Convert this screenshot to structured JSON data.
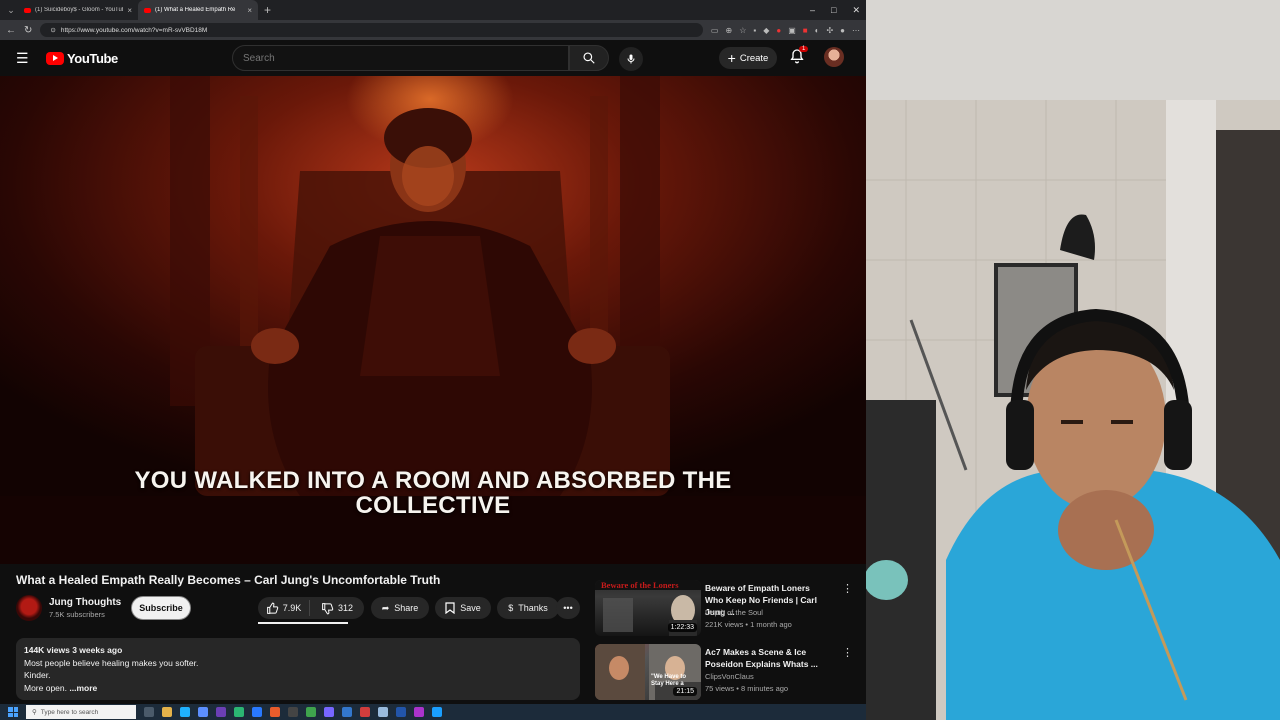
{
  "browser": {
    "tabs": [
      {
        "title": "(1) Suicideboy$ - Gloom - YouTub",
        "active": false
      },
      {
        "title": "(1) What a Healed Empath Re",
        "active": true
      }
    ],
    "url": "https://www.youtube.com/watch?v=mR-svVBD18M"
  },
  "header": {
    "logo_text": "YouTube",
    "search_placeholder": "Search",
    "create_label": "Create",
    "notification_count": "1"
  },
  "video": {
    "caption_line1": "YOU WALKED INTO A ROOM AND ABSORBED THE",
    "caption_line2": "COLLECTIVE",
    "title": "What a Healed Empath Really Becomes – Carl Jung's Uncomfortable Truth"
  },
  "channel": {
    "name": "Jung Thoughts",
    "subscribers": "7.5K subscribers",
    "subscribe_label": "Subscribe"
  },
  "actions": {
    "likes": "7.9K",
    "dislikes": "312",
    "share": "Share",
    "save": "Save",
    "thanks": "Thanks"
  },
  "description": {
    "meta": "144K views  3 weeks ago",
    "line1": "Most people believe healing makes you softer.",
    "line2": "Kinder.",
    "line3": "More open.",
    "more": "...more"
  },
  "related": [
    {
      "title": "Beware of Empath Loners Who Keep No Friends | Carl Jung ...",
      "channel": "Depth of the Soul",
      "meta": "221K views • 1 month ago",
      "duration": "1:22:33",
      "thumb_text": "Beware of the Loners"
    },
    {
      "title": "Ac7 Makes a Scene & Ice Poseidon Explains Whats ...",
      "channel": "ClipsVonClaus",
      "meta": "75 views • 8 minutes ago",
      "duration": "21:15",
      "thumb_text": "\"We Have to Stay Here a"
    }
  ],
  "taskbar": {
    "search_placeholder": "Type here to search"
  },
  "colors": {
    "yt_red": "#ff0000",
    "bg": "#0f0f0f",
    "chip": "#272727",
    "shirt": "#2aa6d8"
  }
}
